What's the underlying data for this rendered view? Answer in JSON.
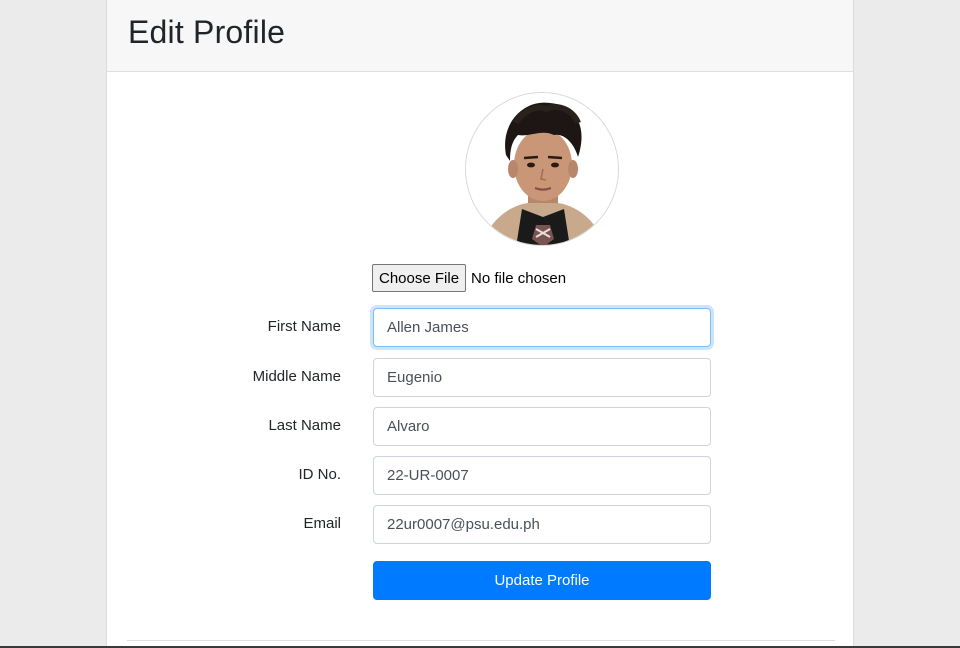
{
  "header": {
    "title": "Edit Profile"
  },
  "avatar": {
    "alt": "Profile photo"
  },
  "file_upload": {
    "button_label": "Choose File",
    "status": "No file chosen"
  },
  "fields": [
    {
      "label": "First Name",
      "value": "Allen James"
    },
    {
      "label": "Middle Name",
      "value": "Eugenio"
    },
    {
      "label": "Last Name",
      "value": "Alvaro"
    },
    {
      "label": "ID No.",
      "value": "22-UR-0007"
    },
    {
      "label": "Email",
      "value": "22ur0007@psu.edu.ph"
    }
  ],
  "submit": {
    "label": "Update Profile"
  },
  "colors": {
    "primary": "#007bff",
    "focus_border": "#80bdff",
    "page_bg": "#ebebeb"
  }
}
